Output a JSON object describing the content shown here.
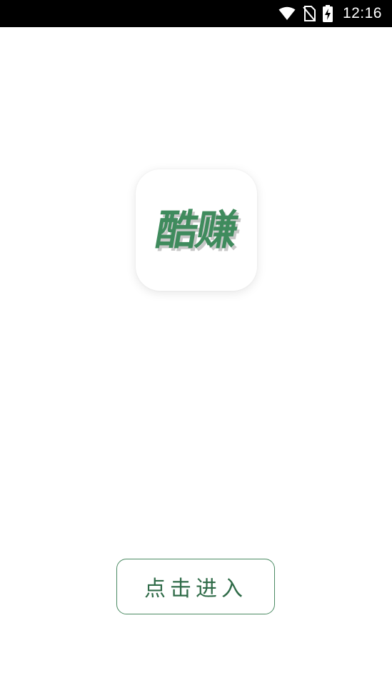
{
  "status_bar": {
    "time": "12:16",
    "icons": [
      "wifi-icon",
      "no-sim-icon",
      "battery-charging-icon"
    ]
  },
  "app_icon": {
    "name": "酷赚",
    "color": "#3f8b5d"
  },
  "enter_button": {
    "label": "点击进入",
    "border_color": "#4a8a62"
  }
}
